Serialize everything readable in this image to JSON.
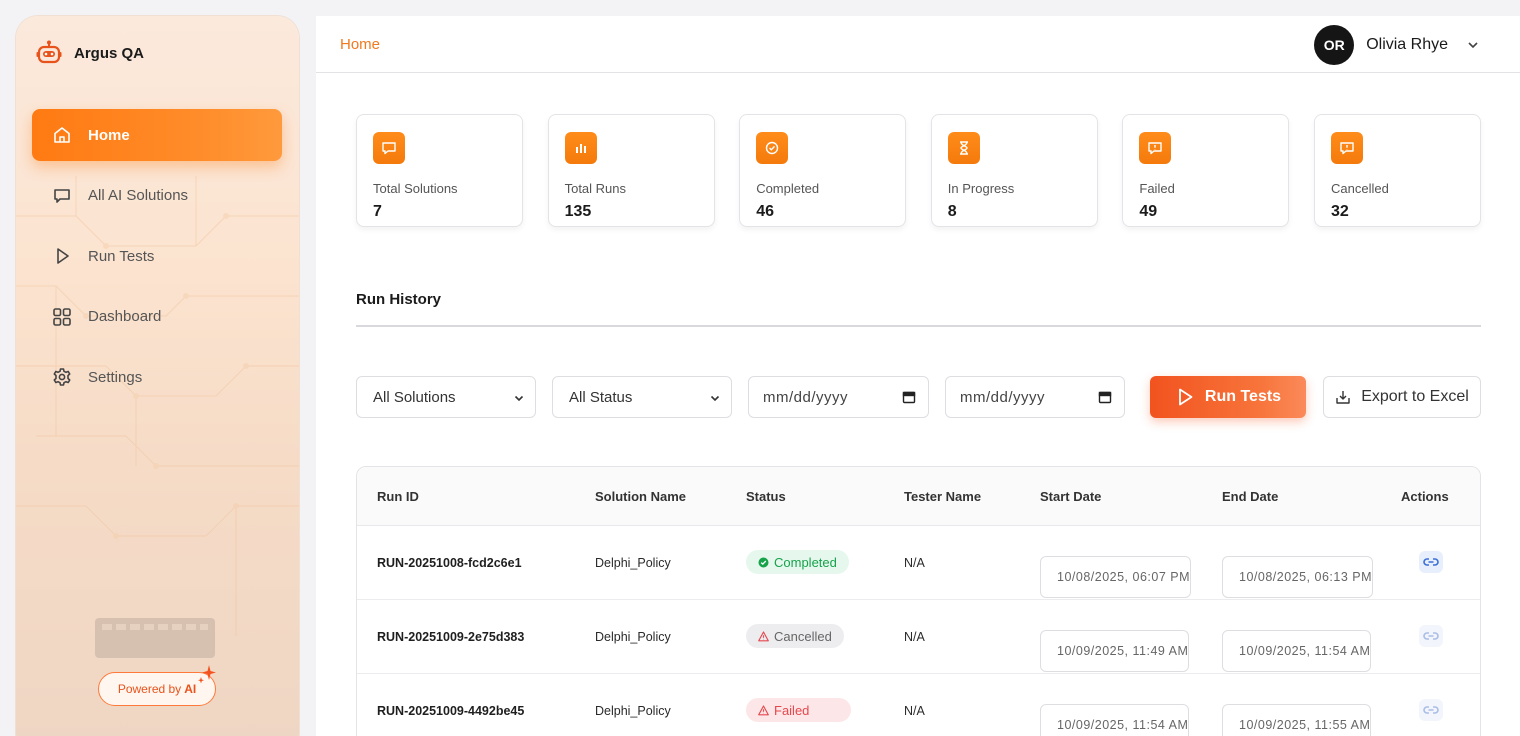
{
  "app": {
    "name": "Argus QA"
  },
  "sidebar": {
    "items": [
      {
        "label": "Home",
        "icon": "home-icon",
        "active": true
      },
      {
        "label": "All AI Solutions",
        "icon": "chat-icon",
        "active": false
      },
      {
        "label": "Run Tests",
        "icon": "play-icon",
        "active": false
      },
      {
        "label": "Dashboard",
        "icon": "grid-icon",
        "active": false
      },
      {
        "label": "Settings",
        "icon": "gear-icon",
        "active": false
      }
    ],
    "powered_label": "Powered by",
    "powered_ai": "AI"
  },
  "header": {
    "breadcrumb": "Home",
    "user": {
      "initials": "OR",
      "name": "Olivia Rhye"
    }
  },
  "stats": [
    {
      "label": "Total Solutions",
      "value": "7",
      "icon": "message-square-icon"
    },
    {
      "label": "Total Runs",
      "value": "135",
      "icon": "bar-chart-icon"
    },
    {
      "label": "Completed",
      "value": "46",
      "icon": "check-circle-icon"
    },
    {
      "label": "In Progress",
      "value": "8",
      "icon": "hourglass-icon"
    },
    {
      "label": "Failed",
      "value": "49",
      "icon": "alert-message-icon"
    },
    {
      "label": "Cancelled",
      "value": "32",
      "icon": "alert-message-icon"
    }
  ],
  "run_history": {
    "title": "Run History",
    "filters": {
      "solution": "All Solutions",
      "status": "All Status",
      "start_date": "mm/dd/yyyy",
      "end_date": "mm/dd/yyyy"
    },
    "run_button": "Run Tests",
    "export_button": "Export to Excel",
    "columns": [
      "Run ID",
      "Solution Name",
      "Status",
      "Tester Name",
      "Start Date",
      "End Date",
      "Actions"
    ],
    "rows": [
      {
        "run_id": "RUN-20251008-fcd2c6e1",
        "solution": "Delphi_Policy",
        "status": "Completed",
        "tester": "N/A",
        "start": "10/08/2025, 06:07 PM",
        "end": "10/08/2025, 06:13 PM"
      },
      {
        "run_id": "RUN-20251009-2e75d383",
        "solution": "Delphi_Policy",
        "status": "Cancelled",
        "tester": "N/A",
        "start": "10/09/2025, 11:49 AM",
        "end": "10/09/2025, 11:54 AM"
      },
      {
        "run_id": "RUN-20251009-4492be45",
        "solution": "Delphi_Policy",
        "status": "Failed",
        "tester": "N/A",
        "start": "10/09/2025, 11:54 AM",
        "end": "10/09/2025, 11:55 AM"
      }
    ]
  },
  "colors": {
    "accent": "#ff7a12",
    "run_button": "#f2531f",
    "breadcrumb": "#f07a1f",
    "link": "#3b6fd8"
  }
}
